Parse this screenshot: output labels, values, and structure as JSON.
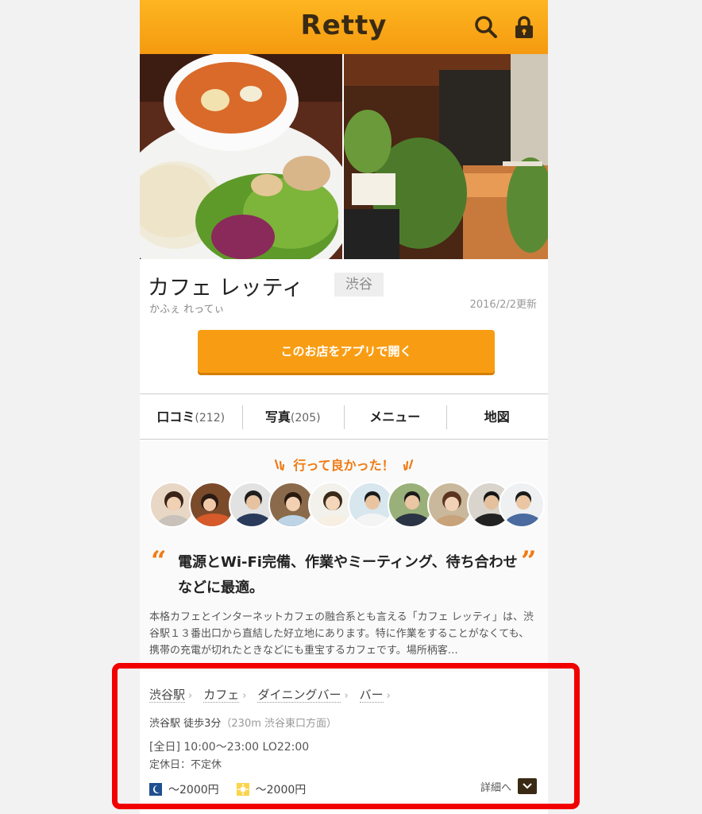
{
  "header": {
    "logo": "Retty",
    "search_icon": "search-icon",
    "lock_icon": "lock-icon",
    "accent": "#f9a713"
  },
  "restaurant": {
    "name": "カフェ レッティ",
    "area": "渋谷",
    "kana": "かふぇ れってぃ",
    "updated": "2016/2/2更新",
    "open_app_label": "このお店をアプリで開く"
  },
  "tabs": [
    {
      "label": "口コミ",
      "count": "(212)"
    },
    {
      "label": "写真",
      "count": "(205)"
    },
    {
      "label": "メニュー",
      "count": ""
    },
    {
      "label": "地図",
      "count": ""
    }
  ],
  "good": {
    "title": "行って良かった！",
    "headline": "電源とWi-Fi完備、作業やミーティング、待ち合わせなどに最適。",
    "open_quote": "“",
    "close_quote": "”",
    "description": "本格カフェとインターネットカフェの融合系とも言える「カフェ レッティ」は、渋谷駅１３番出口から直結した好立地にあります。特に作業をすることがなくても、携帯の充電が切れたときなどにも重宝するカフェです。場所柄客…"
  },
  "info": {
    "categories": [
      "渋谷駅",
      "カフェ",
      "ダイニングバー",
      "バー"
    ],
    "chevron": "›",
    "access": "渋谷駅 徒歩3分",
    "access_note": "（230m 渋谷東口方面）",
    "hours": "[全日] 10:00〜23:00 LO22:00",
    "closed": "定休日：不定休",
    "dinner_price": "〜2000円",
    "lunch_price": "〜2000円",
    "detail_label": "詳細へ"
  }
}
